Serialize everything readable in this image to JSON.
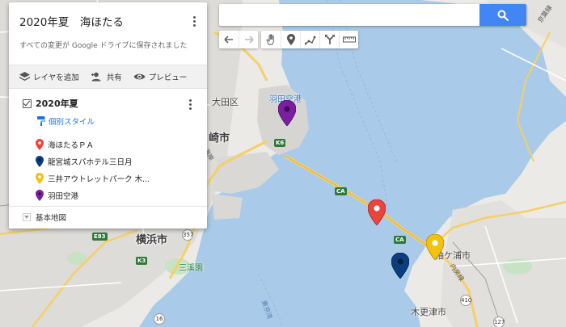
{
  "map_panel": {
    "title": "2020年夏　海ほたる",
    "save_status": "すべての変更が Google ドライブに保存されました",
    "actions": {
      "add_layer": "レイヤを追加",
      "share": "共有",
      "preview": "プレビュー"
    },
    "layer": {
      "title": "2020年夏",
      "style_link": "個別スタイル",
      "places": [
        {
          "label": "海ほたるＰＡ",
          "color": "#e8453c"
        },
        {
          "label": "龍宮城スパホテル三日月",
          "color": "#0b3e7e"
        },
        {
          "label": "三井アウトレットパーク 木...",
          "color": "#f4c20d"
        },
        {
          "label": "羽田空港",
          "color": "#7b1fa2"
        }
      ]
    },
    "basemap_label": "基本地図"
  },
  "search": {
    "value": "",
    "placeholder": ""
  },
  "toolbar": {
    "buttons": [
      "undo-icon",
      "redo-icon",
      "hand-icon",
      "add-marker-icon",
      "draw-line-icon",
      "directions-icon",
      "measure-icon"
    ]
  },
  "map_labels": {
    "ota": "大田区",
    "kawasaki": "崎市",
    "yokohama": "横浜市",
    "haneda": "羽田空港",
    "sankeien": "三溪園",
    "sodegaura": "袖ケ浦市",
    "kisarazu": "木更津市",
    "keiyo": "京葉線",
    "uchibo": "内房線",
    "tokyo_bay_route": "東京湾",
    "kaigan": "海岸",
    "k6": "K6",
    "e83": "E83",
    "k3": "K3",
    "ca1": "CA",
    "ca2": "CA",
    "r357": "357",
    "r16": "16",
    "r410": "410",
    "r127": "127"
  },
  "colors": {
    "water": "#a9cbe9",
    "land": "#eceae6",
    "urban": "#dcdad6",
    "park": "#c7e3c3",
    "highway": "#f5cf67",
    "accent": "#4285f4"
  }
}
